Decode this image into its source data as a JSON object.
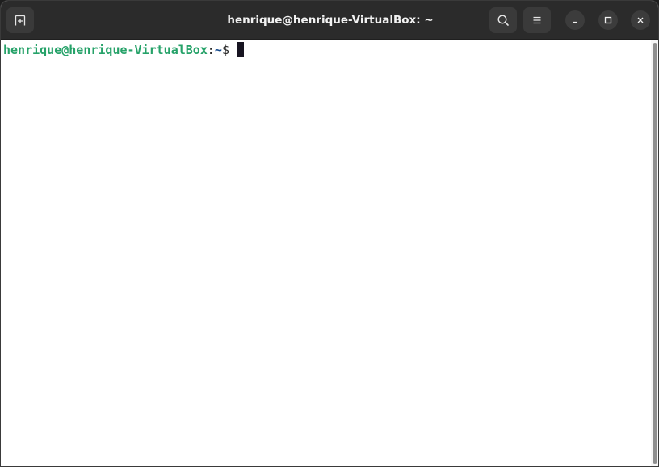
{
  "window": {
    "title": "henrique@henrique-VirtualBox: ~"
  },
  "headerbar": {
    "new_tab_icon": "new-tab-icon",
    "search_icon": "search-icon",
    "menu_icon": "hamburger-menu-icon",
    "minimize_icon": "minimize-icon",
    "maximize_icon": "maximize-icon",
    "close_icon": "close-icon"
  },
  "terminal": {
    "prompt_user_host": "henrique@henrique-VirtualBox",
    "prompt_separator": ":",
    "prompt_path": "~",
    "prompt_symbol": "$",
    "input_text": ""
  },
  "colors": {
    "headerbar_bg": "#2b2b2b",
    "terminal_bg": "#ffffff",
    "prompt_user_color": "#26a269",
    "prompt_path_color": "#12488b",
    "cursor_color": "#171421"
  }
}
